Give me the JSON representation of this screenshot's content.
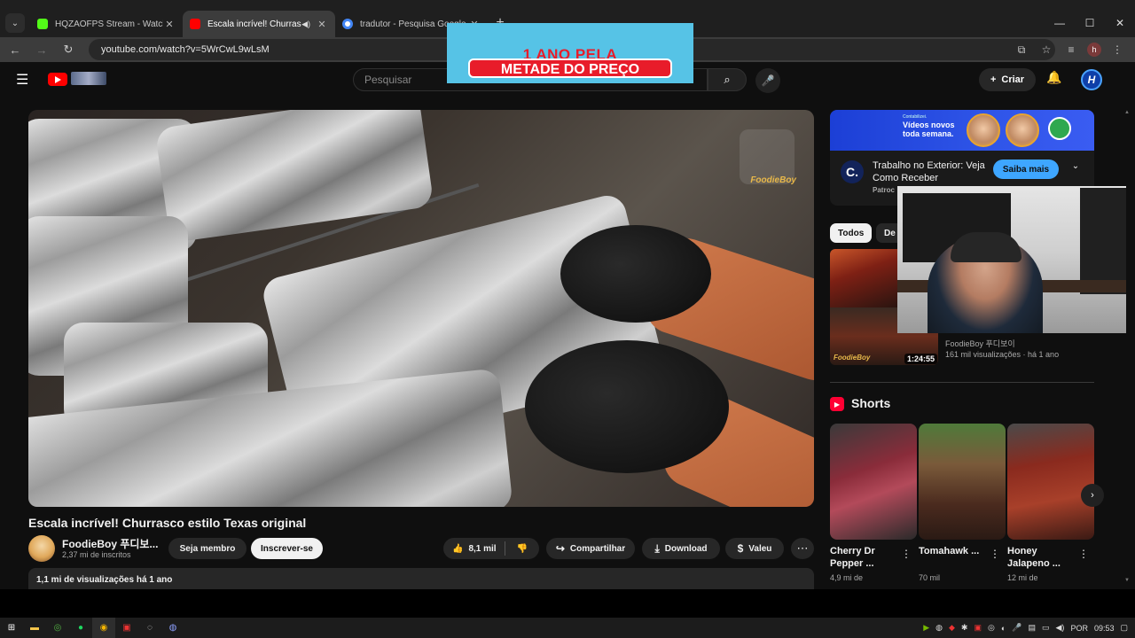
{
  "browser": {
    "tabs": [
      {
        "title": "HQZAOFPS Stream - Watch Live",
        "favicon_color": "#53fc18",
        "active": false
      },
      {
        "title": "Escala incrível! Churrasco estilo",
        "favicon_color": "#ff0000",
        "active": true
      },
      {
        "title": "tradutor - Pesquisa Google",
        "favicon_color": "#4285f4",
        "active": false
      }
    ],
    "url": "youtube.com/watch?v=5WrCwL9wLsM",
    "profile_initial": "h"
  },
  "promo_overlay": {
    "line1": "1 ANO PELA",
    "line2": "METADE DO PREÇO"
  },
  "youtube_header": {
    "search_placeholder": "Pesquisar",
    "create_label": "Criar",
    "avatar_letter": "H"
  },
  "video": {
    "title": "Escala incrível! Churrasco estilo Texas original",
    "watermark": "FoodieBoy",
    "channel_name": "FoodieBoy 푸디보...",
    "subscribers": "2,37 mi de inscritos",
    "join_label": "Seja membro",
    "subscribe_label": "Inscrever-se",
    "likes": "8,1 mil",
    "share_label": "Compartilhar",
    "download_label": "Download",
    "thanks_label": "Valeu",
    "description_meta": "1,1 mi de visualizações  há 1 ano"
  },
  "sidebar": {
    "ad": {
      "banner_small": "Contabilizei.",
      "banner_text": "Vídeos novos toda semana.",
      "logo_letter": "C.",
      "title": "Trabalho no Exterior: Veja Como Receber",
      "sponsor": "Patroc",
      "cta": "Saiba mais"
    },
    "chips": [
      "Todos",
      "De"
    ],
    "recommended": {
      "duration": "1:24:55",
      "thumb_label": "FoodieBoy",
      "channel": "FoodieBoy 푸디보이",
      "meta": "161 mil visualizações · há 1 ano"
    },
    "shorts_title": "Shorts",
    "shorts": [
      {
        "title": "Cherry Dr Pepper ...",
        "views": "4,9 mi de"
      },
      {
        "title": "Tomahawk ...",
        "views": "70 mil"
      },
      {
        "title": "Honey Jalapeno ...",
        "views": "12 mi de"
      }
    ]
  },
  "taskbar": {
    "language": "POR",
    "time": "09:53"
  },
  "colors": {
    "yt_background": "#0f0f0f",
    "accent_red": "#ff0000",
    "cta_blue": "#3ea6ff"
  }
}
